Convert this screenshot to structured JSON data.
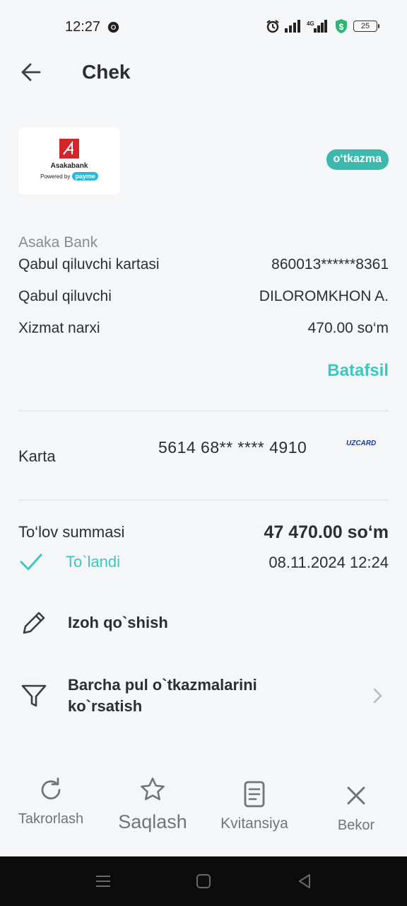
{
  "status_bar": {
    "time": "12:27",
    "battery": "25",
    "icons": [
      "chrome-icon",
      "alarm-icon",
      "signal-icon",
      "4g-signal-icon",
      "shield-dollar-icon",
      "battery-icon"
    ]
  },
  "header": {
    "title": "Chek",
    "back_icon": "arrow-left-icon"
  },
  "merchant": {
    "logo_name": "Asakabank",
    "powered_by": "Powered by",
    "powered_brand": "payme",
    "type_badge": "o‘tkazma"
  },
  "details": {
    "bank_name": "Asaka Bank",
    "rows": [
      {
        "label": "Qabul qiluvchi kartasi",
        "value": "860013******8361"
      },
      {
        "label": "Qabul qiluvchi",
        "value": "DILOROMKHON A."
      },
      {
        "label": "Xizmat narxi",
        "value": "470.00 so‘m"
      }
    ],
    "more_link": "Batafsil"
  },
  "card": {
    "label": "Karta",
    "number": "5614 68** **** 4910",
    "brand": "UZCARD"
  },
  "payment": {
    "label": "To‘lov summasi",
    "amount": "47 470.00 so‘m",
    "status": "To`landi",
    "datetime": "08.11.2024 12:24"
  },
  "actions": [
    {
      "label": "Izoh qo`shish",
      "icon": "pencil-icon"
    },
    {
      "label_line1": "Barcha pul o`tkazmalarini",
      "label_line2": "ko`rsatish",
      "icon": "filter-icon"
    }
  ],
  "toolbar": [
    {
      "label": "Takrorlash",
      "icon": "repeat-icon"
    },
    {
      "label": "Saqlash",
      "icon": "star-icon"
    },
    {
      "label": "Kvitansiya",
      "icon": "receipt-icon"
    },
    {
      "label": "Bekor",
      "icon": "close-icon"
    }
  ],
  "colors": {
    "background": "#f4f6f8",
    "accent": "#3cc8c0",
    "badge": "#3cb8ad",
    "text": "#2b2f33",
    "muted": "#858c92"
  }
}
